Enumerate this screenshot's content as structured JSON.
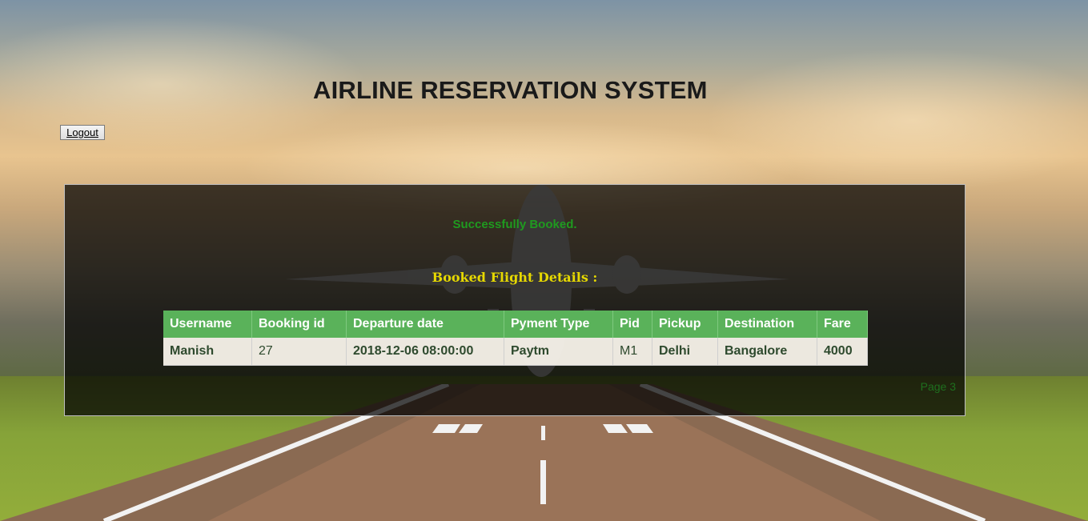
{
  "header": {
    "title": "AIRLINE RESERVATION SYSTEM",
    "logout_label": "Logout"
  },
  "panel": {
    "success_message": "Successfully Booked.",
    "details_heading": "Booked Flight Details :",
    "page_label": "Page 3"
  },
  "table": {
    "headers": [
      "Username",
      "Booking id",
      "Departure date",
      "Pyment Type",
      "Pid",
      "Pickup",
      "Destination",
      "Fare"
    ],
    "rows": [
      [
        "Manish",
        "27",
        "2018-12-06 08:00:00",
        "Paytm",
        "M1",
        "Delhi",
        "Bangalore",
        "4000"
      ]
    ]
  },
  "colors": {
    "success": "#1f9a1f",
    "heading": "#e6d800",
    "table_header": "#5ab25a"
  }
}
